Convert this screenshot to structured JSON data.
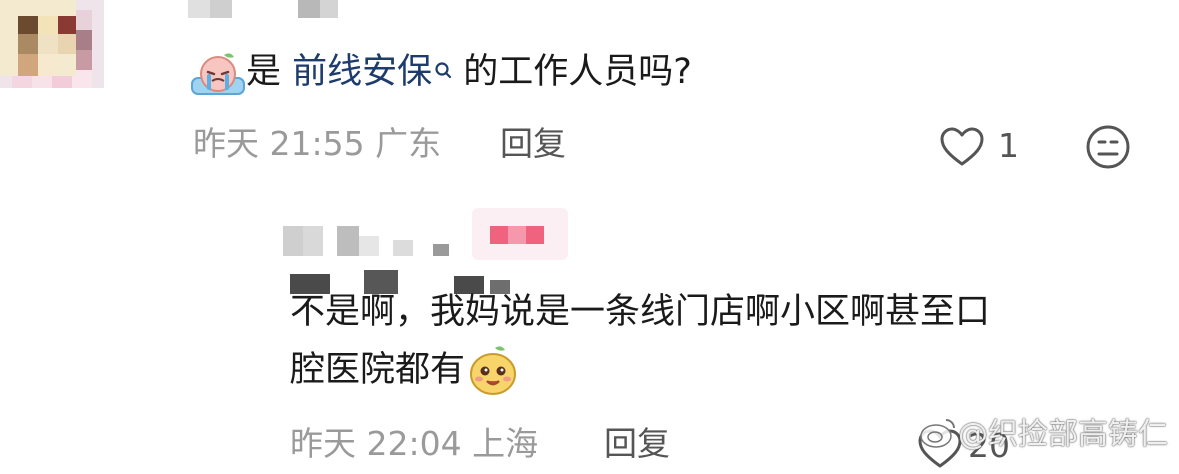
{
  "colors": {
    "link": "#1d3b6d",
    "meta": "#9a9a9a",
    "text": "#1a1a1a"
  },
  "comment": {
    "pre_link": "是 ",
    "link_text": "前线安保",
    "post_link": " 的工作人员吗?",
    "emoji_icon": "crying-emoji-icon",
    "time": "昨天 21:55 广东",
    "reply_label": "回复",
    "like_count": "1"
  },
  "reply": {
    "line1": "不是啊，我妈说是一条线门店啊小区啊甚至口",
    "line2": "腔医院都有",
    "emoji_icon": "smiling-emoji-icon",
    "time": "昨天 22:04 上海",
    "reply_label": "回复",
    "like_count": "20"
  },
  "watermark": "@织捡部高铸仁"
}
